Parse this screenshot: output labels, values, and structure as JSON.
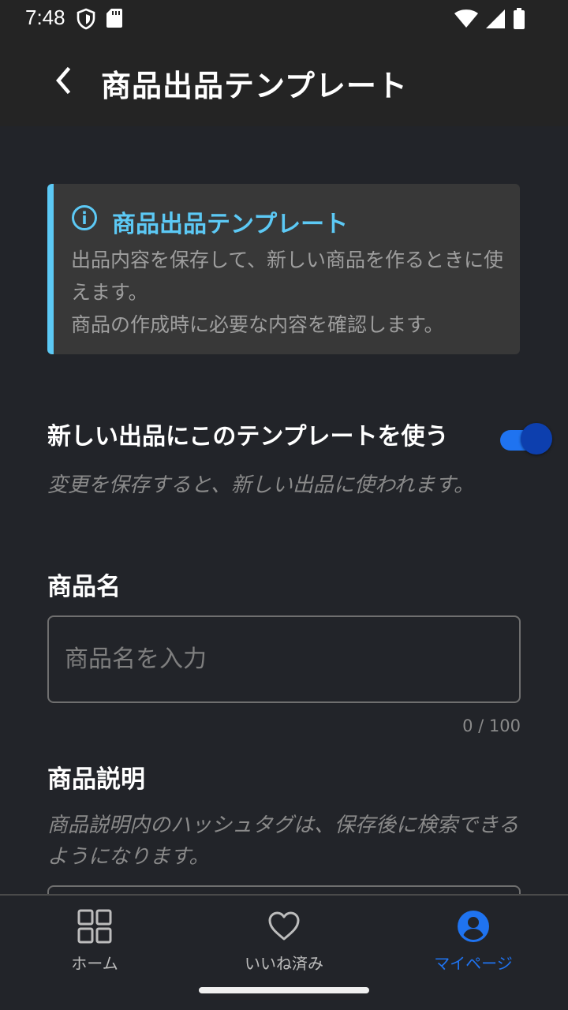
{
  "status_bar": {
    "time": "7:48",
    "icons": [
      "shield-icon",
      "sd-card-icon",
      "wifi-icon",
      "signal-icon",
      "battery-icon"
    ]
  },
  "app_bar": {
    "back_icon": "chevron-left-icon",
    "title": "商品出品テンプレート"
  },
  "info_box": {
    "icon": "info-icon",
    "title": "商品出品テンプレート",
    "line1": "出品内容を保存して、新しい商品を作るときに使えます。",
    "line2": "商品の作成時に必要な内容を確認します。",
    "accent_color": "#5cc9f5"
  },
  "template_toggle": {
    "label": "新しい出品にこのテンプレートを使う",
    "enabled": true,
    "hint": "変更を保存すると、新しい出品に使われます。"
  },
  "product_name": {
    "label": "商品名",
    "placeholder": "商品名を入力",
    "value": "",
    "counter": "0 / 100"
  },
  "product_description": {
    "label": "商品説明",
    "hint": "商品説明内のハッシュタグは、保存後に検索できるようになります。"
  },
  "bottom_nav": {
    "items": [
      {
        "label": "ホーム",
        "icon": "grid-icon",
        "active": false
      },
      {
        "label": "いいね済み",
        "icon": "heart-icon",
        "active": false
      },
      {
        "label": "マイページ",
        "icon": "account-icon",
        "active": true
      }
    ],
    "active_color": "#1f73f0"
  }
}
